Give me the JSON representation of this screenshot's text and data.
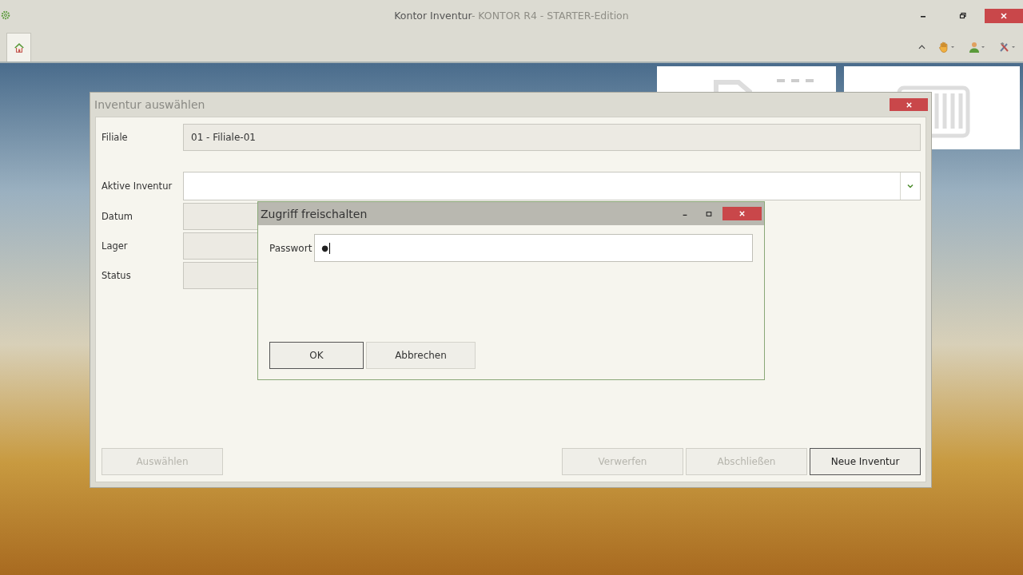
{
  "window": {
    "title": "Kontor Inventur",
    "subtitle": "- KONTOR R4 - STARTER-Edition"
  },
  "toolbar": {
    "tabs": [
      {
        "kind": "home",
        "selected": true
      }
    ]
  },
  "main_dialog": {
    "title": "Inventur auswählen",
    "fields": [
      {
        "label": "Filiale",
        "kind": "readonly",
        "value": "01 - Filiale-01"
      },
      {
        "label": "Aktive Inventur",
        "kind": "combo"
      },
      {
        "label": "Datum",
        "kind": "readonly"
      },
      {
        "label": "Lager",
        "kind": "readonly"
      },
      {
        "label": "Status",
        "kind": "readonly"
      }
    ],
    "left_buttons": [
      {
        "label": "Auswählen",
        "disabled": true
      }
    ],
    "right_buttons": [
      {
        "label": "Verwerfen",
        "disabled": true
      },
      {
        "label": "Abschließen",
        "disabled": true
      },
      {
        "label": "Neue Inventur",
        "disabled": false
      }
    ]
  },
  "password_dialog": {
    "title": "Zugriff freischalten",
    "label": "Passwort",
    "value": "●",
    "buttons": [
      {
        "label": "OK",
        "default": true
      },
      {
        "label": "Abbrechen",
        "default": false
      }
    ]
  }
}
